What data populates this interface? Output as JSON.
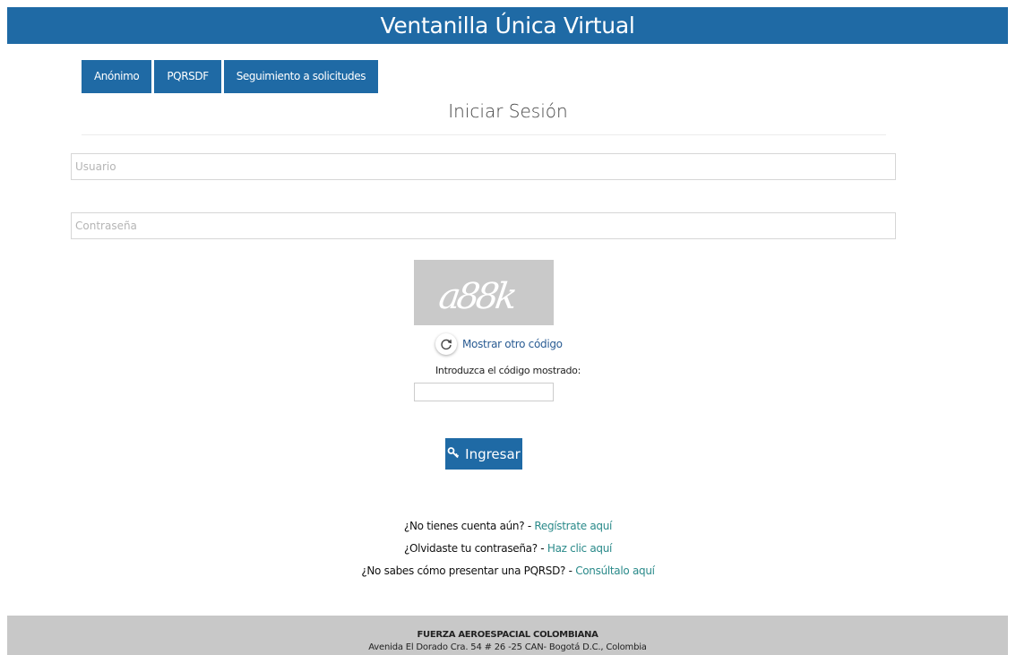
{
  "header": {
    "title": "Ventanilla Única Virtual"
  },
  "nav": {
    "items": [
      {
        "label": "Anónimo"
      },
      {
        "label": "PQRSDF"
      },
      {
        "label": "Seguimiento a solicitudes"
      }
    ]
  },
  "login": {
    "title": "Iniciar Sesión",
    "username_placeholder": "Usuario",
    "password_placeholder": "Contraseña",
    "captcha_text": "a88k",
    "refresh_label": "Mostrar otro código",
    "code_label": "Introduzca el código mostrado:",
    "submit_label": "Ingresar"
  },
  "help_links": [
    {
      "question": "¿No tienes cuenta aún? -",
      "link": "Regístrate aquí"
    },
    {
      "question": "¿Olvidaste tu contraseña? -",
      "link": "Haz clic aquí"
    },
    {
      "question": "¿No sabes cómo presentar una PQRSD? -",
      "link": "Consúltalo aquí"
    }
  ],
  "footer": {
    "org": "FUERZA AEROESPACIAL COLOMBIANA",
    "address": "Avenida El Dorado Cra. 54 # 26 -25 CAN- Bogotá D.C., Colombia"
  },
  "colors": {
    "primary": "#1f6aa5",
    "link": "#2a8a8a",
    "footer_bg": "#c8c8c8"
  }
}
